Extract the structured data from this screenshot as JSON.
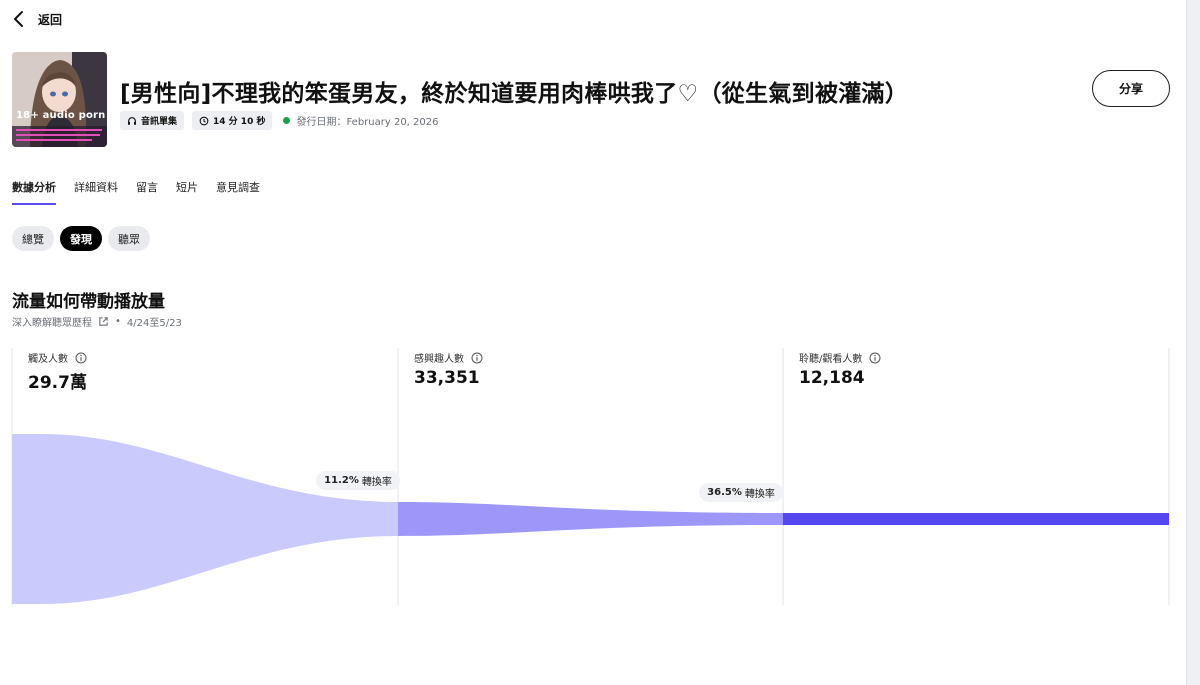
{
  "nav": {
    "back_label": "返回"
  },
  "cover": {
    "tag": "18+ audio porn"
  },
  "episode": {
    "title": "[男性向]不理我的笨蛋男友，終於知道要用肉棒哄我了♡（從生氣到被灌滿）",
    "type_chip": "音訊單集",
    "duration_chip": "14 分 10 秒",
    "release": "發行日期：February 20, 2026"
  },
  "actions": {
    "share_label": "分享"
  },
  "tabs": [
    "數據分析",
    "詳細資料",
    "留言",
    "短片",
    "意見調查"
  ],
  "active_tab": 0,
  "pills": [
    "總覽",
    "發現",
    "聽眾"
  ],
  "active_pill": 1,
  "section": {
    "title": "流量如何帶動播放量",
    "link_label": "深入瞭解聽眾歷程",
    "separator": "•",
    "date_range": "4/24至5/23"
  },
  "chart_data": {
    "type": "funnel",
    "stages": [
      {
        "label": "觸及人數",
        "value_text": "29.7萬",
        "value": 297000
      },
      {
        "label": "感興趣人數",
        "value_text": "33,351",
        "value": 33351
      },
      {
        "label": "聆聽/觀看人數",
        "value_text": "12,184",
        "value": 12184
      }
    ],
    "conversions": [
      {
        "rate": "11.2%",
        "label": "轉換率"
      },
      {
        "rate": "36.5%",
        "label": "轉換率"
      }
    ]
  },
  "colors": {
    "stage1": "#cbcafc",
    "stage2": "#9d97fa",
    "stage3": "#5347ed",
    "tab_underline": "#5b4de8",
    "release_dot": "#17a34a"
  },
  "icons": {
    "back": "chevron-left-icon",
    "type_chip": "headphones-icon",
    "duration_chip": "clock-icon",
    "link": "external-link-icon",
    "info": "info-icon"
  }
}
